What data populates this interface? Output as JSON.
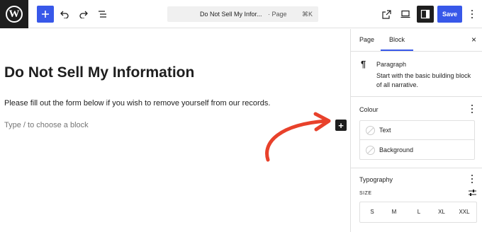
{
  "toolbar": {
    "logo_letter": "W",
    "doc_title": "Do Not Sell My Infor...",
    "doc_type": "· Page",
    "shortcut": "⌘K",
    "save_label": "Save"
  },
  "editor": {
    "title": "Do Not Sell My Information",
    "paragraph": "Please fill out the form below if you wish to remove yourself from our records.",
    "placeholder": "Type / to choose a block",
    "inserter_symbol": "+"
  },
  "sidebar": {
    "tabs": [
      {
        "label": "Page"
      },
      {
        "label": "Block"
      }
    ],
    "close_symbol": "×",
    "block": {
      "icon": "¶",
      "name": "Paragraph",
      "description": "Start with the basic building block of all narrative."
    },
    "colour": {
      "title": "Colour",
      "items": [
        {
          "label": "Text"
        },
        {
          "label": "Background"
        }
      ]
    },
    "typography": {
      "title": "Typography",
      "size_label": "SIZE",
      "sizes": [
        "S",
        "M",
        "L",
        "XL",
        "XXL"
      ]
    }
  },
  "colors": {
    "accent": "#3858e9",
    "dark": "#1e1e1e",
    "annotation_arrow": "#e8412b"
  }
}
